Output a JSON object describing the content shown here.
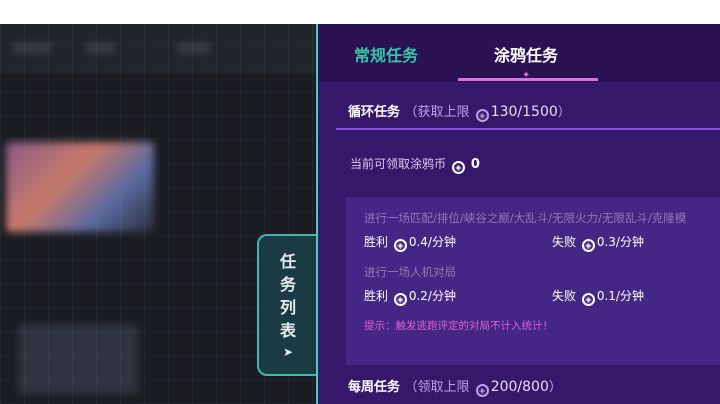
{
  "tab_panel": {
    "chars": [
      "任",
      "务",
      "列",
      "表"
    ],
    "arrow": "➤"
  },
  "tabs": [
    {
      "label": "常规任务"
    },
    {
      "label": "涂鸦任务"
    }
  ],
  "loop_section": {
    "title": "循环任务",
    "limit_prefix": "（获取上限",
    "limit_value": "130/1500",
    "limit_suffix": "）"
  },
  "current": {
    "label": "当前可领取涂鸦币",
    "value": "0"
  },
  "rules": [
    {
      "desc": "进行一场匹配/排位/峡谷之巅/大乱斗/无限火力/无限乱斗/克隆模",
      "win_label": "胜利",
      "win_rate": "0.4/分钟",
      "lose_label": "失败",
      "lose_rate": "0.3/分钟"
    },
    {
      "desc": "进行一场人机对局",
      "win_label": "胜利",
      "win_rate": "0.2/分钟",
      "lose_label": "失败",
      "lose_rate": "0.1/分钟"
    }
  ],
  "warning": "提示：触发逃跑评定的对局不计入统计！",
  "weekly_section": {
    "title": "每周任务",
    "limit_prefix": "（领取上限",
    "limit_value": "200/800",
    "limit_suffix": "）"
  },
  "colors": {
    "panel_bg": "#36186b",
    "accent_teal": "#39c6a8",
    "accent_pink": "#e26fe0",
    "warning": "#e05ed8"
  }
}
